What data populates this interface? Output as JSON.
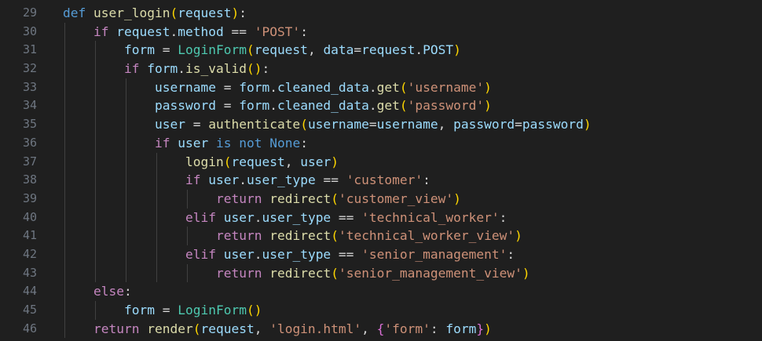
{
  "editor": {
    "lines": [
      {
        "num": "29",
        "indent": 0,
        "tokens": [
          [
            "kw",
            "def"
          ],
          [
            "op",
            " "
          ],
          [
            "fn",
            "user_login"
          ],
          [
            "p1",
            "("
          ],
          [
            "var",
            "request"
          ],
          [
            "p1",
            ")"
          ],
          [
            "op",
            ":"
          ]
        ]
      },
      {
        "num": "30",
        "indent": 1,
        "tokens": [
          [
            "kw-ctrl",
            "if"
          ],
          [
            "op",
            " "
          ],
          [
            "var",
            "request"
          ],
          [
            "op",
            "."
          ],
          [
            "var",
            "method"
          ],
          [
            "op",
            " == "
          ],
          [
            "str",
            "'POST'"
          ],
          [
            "op",
            ":"
          ]
        ]
      },
      {
        "num": "31",
        "indent": 2,
        "tokens": [
          [
            "var",
            "form"
          ],
          [
            "op",
            " = "
          ],
          [
            "cls",
            "LoginForm"
          ],
          [
            "p1",
            "("
          ],
          [
            "var",
            "request"
          ],
          [
            "op",
            ", "
          ],
          [
            "var",
            "data"
          ],
          [
            "op",
            "="
          ],
          [
            "var",
            "request"
          ],
          [
            "op",
            "."
          ],
          [
            "var",
            "POST"
          ],
          [
            "p1",
            ")"
          ]
        ]
      },
      {
        "num": "32",
        "indent": 2,
        "tokens": [
          [
            "kw-ctrl",
            "if"
          ],
          [
            "op",
            " "
          ],
          [
            "var",
            "form"
          ],
          [
            "op",
            "."
          ],
          [
            "fn",
            "is_valid"
          ],
          [
            "p1",
            "()"
          ],
          [
            "op",
            ":"
          ]
        ]
      },
      {
        "num": "33",
        "indent": 3,
        "tokens": [
          [
            "var",
            "username"
          ],
          [
            "op",
            " = "
          ],
          [
            "var",
            "form"
          ],
          [
            "op",
            "."
          ],
          [
            "var",
            "cleaned_data"
          ],
          [
            "op",
            "."
          ],
          [
            "fn",
            "get"
          ],
          [
            "p1",
            "("
          ],
          [
            "str",
            "'username'"
          ],
          [
            "p1",
            ")"
          ]
        ]
      },
      {
        "num": "34",
        "indent": 3,
        "tokens": [
          [
            "var",
            "password"
          ],
          [
            "op",
            " = "
          ],
          [
            "var",
            "form"
          ],
          [
            "op",
            "."
          ],
          [
            "var",
            "cleaned_data"
          ],
          [
            "op",
            "."
          ],
          [
            "fn",
            "get"
          ],
          [
            "p1",
            "("
          ],
          [
            "str",
            "'password'"
          ],
          [
            "p1",
            ")"
          ]
        ]
      },
      {
        "num": "35",
        "indent": 3,
        "tokens": [
          [
            "var",
            "user"
          ],
          [
            "op",
            " = "
          ],
          [
            "fn",
            "authenticate"
          ],
          [
            "p1",
            "("
          ],
          [
            "var",
            "username"
          ],
          [
            "op",
            "="
          ],
          [
            "var",
            "username"
          ],
          [
            "op",
            ", "
          ],
          [
            "var",
            "password"
          ],
          [
            "op",
            "="
          ],
          [
            "var",
            "password"
          ],
          [
            "p1",
            ")"
          ]
        ]
      },
      {
        "num": "36",
        "indent": 3,
        "tokens": [
          [
            "kw-ctrl",
            "if"
          ],
          [
            "op",
            " "
          ],
          [
            "var",
            "user"
          ],
          [
            "op",
            " "
          ],
          [
            "kw",
            "is"
          ],
          [
            "op",
            " "
          ],
          [
            "kw",
            "not"
          ],
          [
            "op",
            " "
          ],
          [
            "kw",
            "None"
          ],
          [
            "op",
            ":"
          ]
        ]
      },
      {
        "num": "37",
        "indent": 4,
        "tokens": [
          [
            "fn",
            "login"
          ],
          [
            "p1",
            "("
          ],
          [
            "var",
            "request"
          ],
          [
            "op",
            ", "
          ],
          [
            "var",
            "user"
          ],
          [
            "p1",
            ")"
          ]
        ]
      },
      {
        "num": "38",
        "indent": 4,
        "tokens": [
          [
            "kw-ctrl",
            "if"
          ],
          [
            "op",
            " "
          ],
          [
            "var",
            "user"
          ],
          [
            "op",
            "."
          ],
          [
            "var",
            "user_type"
          ],
          [
            "op",
            " == "
          ],
          [
            "str",
            "'customer'"
          ],
          [
            "op",
            ":"
          ]
        ]
      },
      {
        "num": "39",
        "indent": 5,
        "tokens": [
          [
            "kw-ctrl",
            "return"
          ],
          [
            "op",
            " "
          ],
          [
            "fn",
            "redirect"
          ],
          [
            "p1",
            "("
          ],
          [
            "str",
            "'customer_view'"
          ],
          [
            "p1",
            ")"
          ]
        ]
      },
      {
        "num": "40",
        "indent": 4,
        "tokens": [
          [
            "kw-ctrl",
            "elif"
          ],
          [
            "op",
            " "
          ],
          [
            "var",
            "user"
          ],
          [
            "op",
            "."
          ],
          [
            "var",
            "user_type"
          ],
          [
            "op",
            " == "
          ],
          [
            "str",
            "'technical_worker'"
          ],
          [
            "op",
            ":"
          ]
        ]
      },
      {
        "num": "41",
        "indent": 5,
        "tokens": [
          [
            "kw-ctrl",
            "return"
          ],
          [
            "op",
            " "
          ],
          [
            "fn",
            "redirect"
          ],
          [
            "p1",
            "("
          ],
          [
            "str",
            "'technical_worker_view'"
          ],
          [
            "p1",
            ")"
          ]
        ]
      },
      {
        "num": "42",
        "indent": 4,
        "tokens": [
          [
            "kw-ctrl",
            "elif"
          ],
          [
            "op",
            " "
          ],
          [
            "var",
            "user"
          ],
          [
            "op",
            "."
          ],
          [
            "var",
            "user_type"
          ],
          [
            "op",
            " == "
          ],
          [
            "str",
            "'senior_management'"
          ],
          [
            "op",
            ":"
          ]
        ]
      },
      {
        "num": "43",
        "indent": 5,
        "tokens": [
          [
            "kw-ctrl",
            "return"
          ],
          [
            "op",
            " "
          ],
          [
            "fn",
            "redirect"
          ],
          [
            "p1",
            "("
          ],
          [
            "str",
            "'senior_management_view'"
          ],
          [
            "p1",
            ")"
          ]
        ]
      },
      {
        "num": "44",
        "indent": 1,
        "tokens": [
          [
            "kw-ctrl",
            "else"
          ],
          [
            "op",
            ":"
          ]
        ]
      },
      {
        "num": "45",
        "indent": 2,
        "tokens": [
          [
            "var",
            "form"
          ],
          [
            "op",
            " = "
          ],
          [
            "cls",
            "LoginForm"
          ],
          [
            "p1",
            "()"
          ]
        ]
      },
      {
        "num": "46",
        "indent": 1,
        "tokens": [
          [
            "kw-ctrl",
            "return"
          ],
          [
            "op",
            " "
          ],
          [
            "fn",
            "render"
          ],
          [
            "p1",
            "("
          ],
          [
            "var",
            "request"
          ],
          [
            "op",
            ", "
          ],
          [
            "str",
            "'login.html'"
          ],
          [
            "op",
            ", "
          ],
          [
            "p2",
            "{"
          ],
          [
            "str",
            "'form'"
          ],
          [
            "op",
            ": "
          ],
          [
            "var",
            "form"
          ],
          [
            "p2",
            "}"
          ],
          [
            "p1",
            ")"
          ]
        ]
      }
    ]
  },
  "colors": {
    "background": "#1f1f1f",
    "line_number": "#6e7681",
    "indent_guide": "#404040"
  }
}
